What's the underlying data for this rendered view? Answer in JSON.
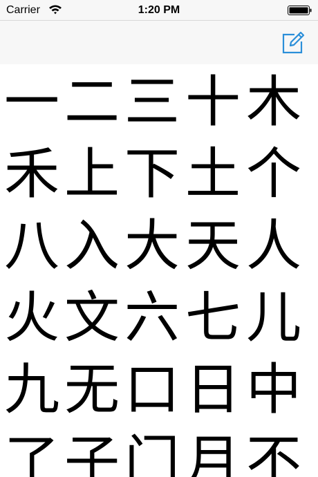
{
  "status_bar": {
    "carrier": "Carrier",
    "time": "1:20 PM",
    "wifi_icon": "wifi-icon",
    "battery_icon": "battery-icon"
  },
  "nav_bar": {
    "compose_icon": "compose-icon",
    "accent_color": "#2b8fd9"
  },
  "characters": [
    [
      "一",
      "二",
      "三",
      "十",
      "木"
    ],
    [
      "禾",
      "上",
      "下",
      "土",
      "个"
    ],
    [
      "八",
      "入",
      "大",
      "天",
      "人"
    ],
    [
      "火",
      "文",
      "六",
      "七",
      "儿"
    ],
    [
      "九",
      "无",
      "口",
      "日",
      "中"
    ],
    [
      "了",
      "子",
      "门",
      "月",
      "不"
    ]
  ]
}
